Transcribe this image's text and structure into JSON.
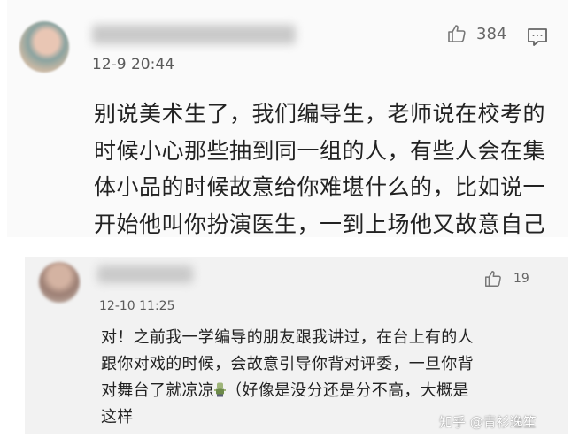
{
  "comment1": {
    "timestamp": "12-9 20:44",
    "likes": "384",
    "text": "别说美术生了，我们编导生，老师说在校考的\n时候小心那些抽到同一组的人，有些人会在集\n体小品的时候故意给你难堪什么的，比如说一\n开始他叫你扮演医生，一到上场他又故意自己\n当医生这样"
  },
  "comment2": {
    "timestamp": "12-10 11:25",
    "likes": "19",
    "text_part1": "对！之前我一学编导的朋友跟我讲过，在台上有的人\n跟你对戏的时候，会故意引导你背对评委，一旦你背\n对舞台了就凉凉",
    "text_part2": "（好像是没分还是分不高，大概是\n这样"
  },
  "watermark": "知乎 @青衫逸笙",
  "icons": [
    "thumbs-up-icon",
    "comment-reply-icon",
    "zombie-emoji"
  ]
}
